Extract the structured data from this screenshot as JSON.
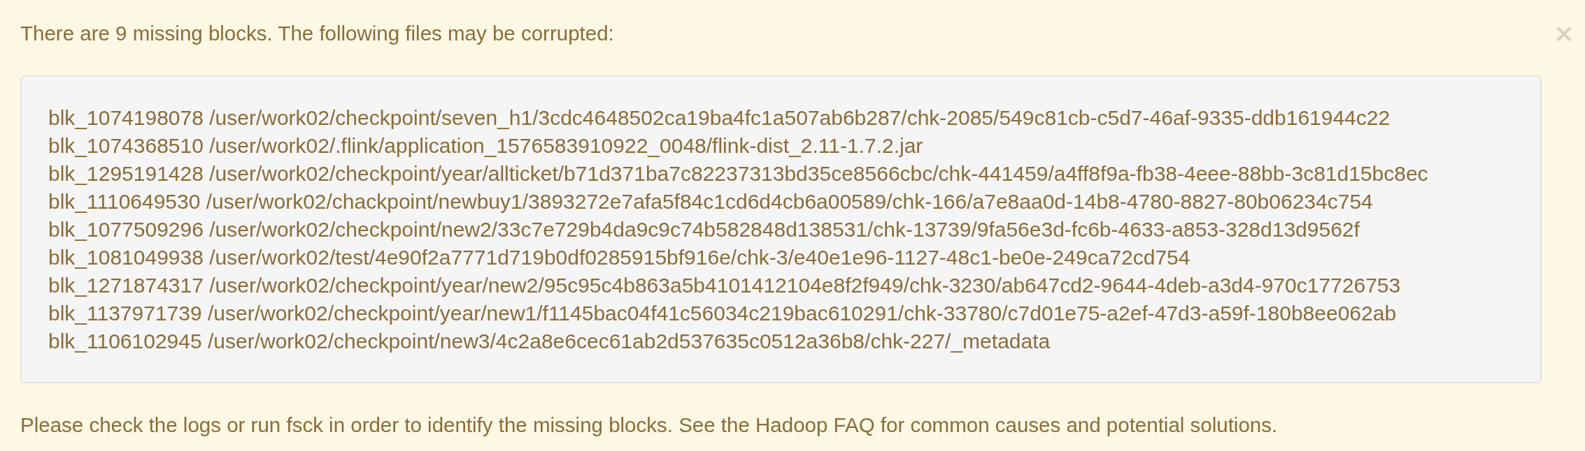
{
  "alert": {
    "message": "There are 9 missing blocks. The following files may be corrupted:",
    "close_label": "×",
    "corrupted_files": [
      "blk_1074198078 /user/work02/checkpoint/seven_h1/3cdc4648502ca19ba4fc1a507ab6b287/chk-2085/549c81cb-c5d7-46af-9335-ddb161944c22",
      "blk_1074368510 /user/work02/.flink/application_1576583910922_0048/flink-dist_2.11-1.7.2.jar",
      "blk_1295191428 /user/work02/checkpoint/year/allticket/b71d371ba7c82237313bd35ce8566cbc/chk-441459/a4ff8f9a-fb38-4eee-88bb-3c81d15bc8ec",
      "blk_1110649530 /user/work02/chackpoint/newbuy1/3893272e7afa5f84c1cd6d4cb6a00589/chk-166/a7e8aa0d-14b8-4780-8827-80b06234c754",
      "blk_1077509296 /user/work02/checkpoint/new2/33c7e729b4da9c9c74b582848d138531/chk-13739/9fa56e3d-fc6b-4633-a853-328d13d9562f",
      "blk_1081049938 /user/work02/test/4e90f2a7771d719b0df0285915bf916e/chk-3/e40e1e96-1127-48c1-be0e-249ca72cd754",
      "blk_1271874317 /user/work02/checkpoint/year/new2/95c95c4b863a5b4101412104e8f2f949/chk-3230/ab647cd2-9644-4deb-a3d4-970c17726753",
      "blk_1137971739 /user/work02/checkpoint/year/new1/f1145bac04f41c56034c219bac610291/chk-33780/c7d01e75-a2ef-47d3-a59f-180b8ee062ab",
      "blk_1106102945 /user/work02/checkpoint/new3/4c2a8e6cec61ab2d537635c0512a36b8/chk-227/_metadata"
    ],
    "footer": "Please check the logs or run fsck in order to identify the missing blocks. See the Hadoop FAQ for common causes and potential solutions."
  }
}
